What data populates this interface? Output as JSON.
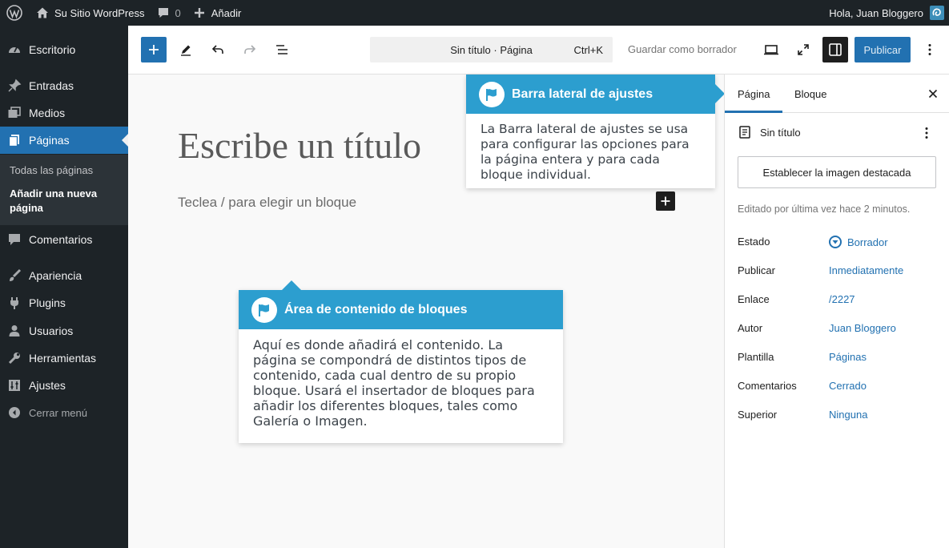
{
  "admin_bar": {
    "site_name": "Su Sitio WordPress",
    "comments_count": "0",
    "add_new": "Añadir",
    "greeting": "Hola, Juan Bloggero"
  },
  "admin_menu": {
    "items": [
      {
        "label": "Escritorio",
        "icon": "dashboard-icon"
      },
      {
        "label": "Entradas",
        "icon": "pin-icon"
      },
      {
        "label": "Medios",
        "icon": "media-icon"
      },
      {
        "label": "Páginas",
        "icon": "pages-icon"
      },
      {
        "label": "Comentarios",
        "icon": "comment-icon"
      },
      {
        "label": "Apariencia",
        "icon": "brush-icon"
      },
      {
        "label": "Plugins",
        "icon": "plugin-icon"
      },
      {
        "label": "Usuarios",
        "icon": "user-icon"
      },
      {
        "label": "Herramientas",
        "icon": "wrench-icon"
      },
      {
        "label": "Ajustes",
        "icon": "settings-icon"
      }
    ],
    "submenu": [
      "Todas las páginas",
      "Añadir una nueva página"
    ],
    "collapse": "Cerrar menú"
  },
  "toolbar": {
    "doc_title": "Sin título · Página",
    "shortcut": "Ctrl+K",
    "save_draft": "Guardar como borrador",
    "publish": "Publicar"
  },
  "canvas": {
    "title_placeholder": "Escribe un título",
    "block_placeholder": "Teclea / para elegir un bloque"
  },
  "pointers": [
    {
      "title": "Barra lateral de ajustes",
      "body": "La Barra lateral de ajustes se usa para configurar las opciones para la página entera y para cada bloque individual."
    },
    {
      "title": "Área de contenido de bloques",
      "body": "Aquí es donde añadirá el contenido. La página se compondrá de distintos tipos de contenido, cada cual dentro de su propio bloque. Usará el insertador de bloques para añadir los diferentes bloques, tales como Galería o Imagen."
    }
  ],
  "sidebar": {
    "tabs": [
      "Página",
      "Bloque"
    ],
    "doc_name": "Sin título",
    "featured_image": "Establecer la imagen destacada",
    "edited": "Editado por última vez hace 2 minutos.",
    "meta": [
      {
        "label": "Estado",
        "value": "Borrador"
      },
      {
        "label": "Publicar",
        "value": "Inmediatamente"
      },
      {
        "label": "Enlace",
        "value": "/2227"
      },
      {
        "label": "Autor",
        "value": "Juan Bloggero"
      },
      {
        "label": "Plantilla",
        "value": "Páginas"
      },
      {
        "label": "Comentarios",
        "value": "Cerrado"
      },
      {
        "label": "Superior",
        "value": "Ninguna"
      }
    ]
  },
  "colors": {
    "admin_dark": "#1d2327",
    "accent": "#2271b1",
    "pointer_blue": "#2c9ecf"
  }
}
